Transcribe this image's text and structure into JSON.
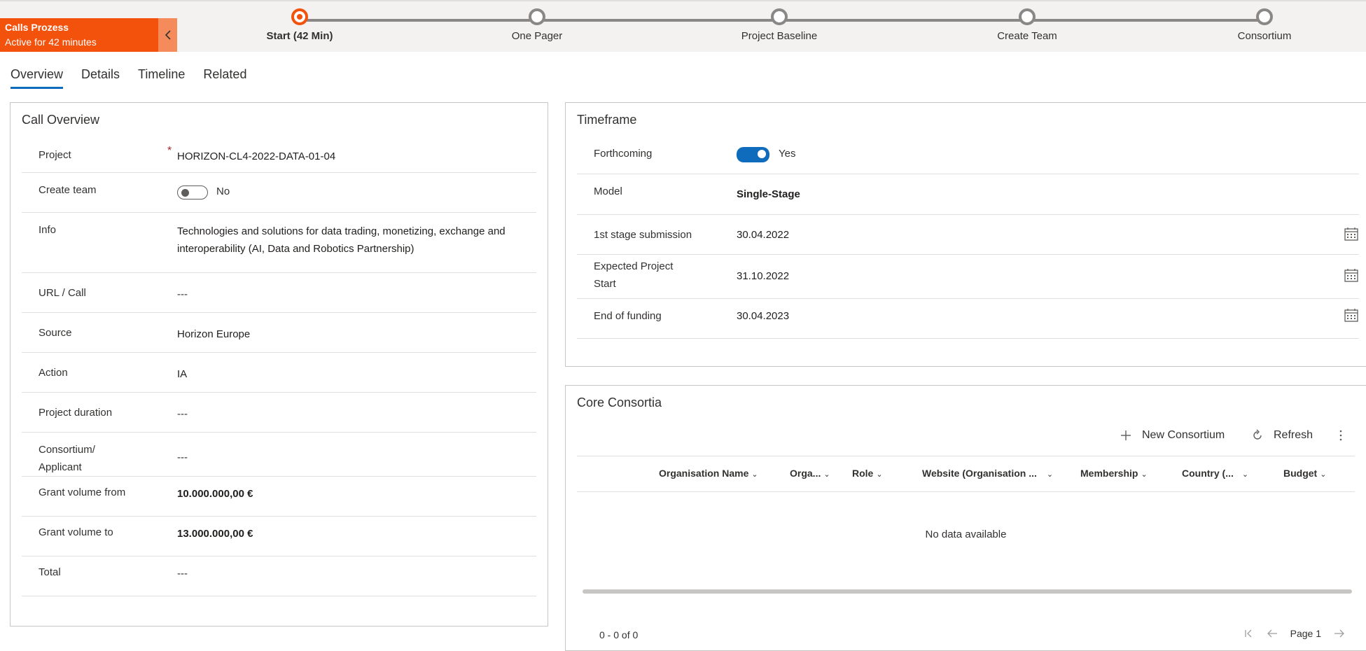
{
  "process": {
    "active_stage_name": "Calls Prozess",
    "active_stage_status": "Active for 42 minutes",
    "stages": [
      {
        "label": "Start  (42 Min)"
      },
      {
        "label": "One Pager"
      },
      {
        "label": "Project Baseline"
      },
      {
        "label": "Create Team"
      },
      {
        "label": "Consortium"
      }
    ]
  },
  "tabs": [
    "Overview",
    "Details",
    "Timeline",
    "Related"
  ],
  "call_overview": {
    "title": "Call Overview",
    "project_label": "Project",
    "project_required": "*",
    "project_value": "HORIZON-CL4-2022-DATA-01-04",
    "create_team_label": "Create team",
    "create_team_value": "No",
    "info_label": "Info",
    "info_value": "Technologies and solutions for data trading, monetizing, exchange and interoperability (AI, Data and Robotics Partnership)",
    "url_label": "URL / Call",
    "url_value": "---",
    "source_label": "Source",
    "source_value": "Horizon Europe",
    "action_label": "Action",
    "action_value": "IA",
    "duration_label": "Project duration",
    "duration_value": "---",
    "consortium_label": "Consortium/ Applicant",
    "consortium_value": "---",
    "grant_from_label": "Grant volume from",
    "grant_from_value": "10.000.000,00 €",
    "grant_to_label": "Grant volume to",
    "grant_to_value": "13.000.000,00 €",
    "total_label": "Total",
    "total_value": "---"
  },
  "timeframe": {
    "title": "Timeframe",
    "forthcoming_label": "Forthcoming",
    "forthcoming_value": "Yes",
    "model_label": "Model",
    "model_value": "Single-Stage",
    "first_stage_label": "1st stage submission",
    "first_stage_value": "30.04.2022",
    "expected_start_label": "Expected Project Start",
    "expected_start_value": "31.10.2022",
    "end_funding_label": "End of funding",
    "end_funding_value": "30.04.2023"
  },
  "core_consortia": {
    "title": "Core Consortia",
    "new_label": "New Consortium",
    "refresh_label": "Refresh",
    "columns": [
      "Organisation Name",
      "Orga...",
      "Role",
      "Website (Organisation ...",
      "Membership",
      "Country (...",
      "Budget"
    ],
    "empty_text": "No data available",
    "record_count": "0 - 0 of 0",
    "page_label": "Page 1"
  },
  "colors": {
    "accent_orange": "#f2520c",
    "toggle_blue": "#0f6cbd"
  }
}
